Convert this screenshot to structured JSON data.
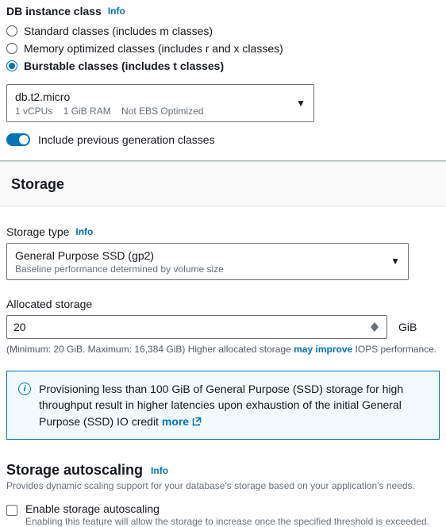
{
  "instance_class": {
    "label": "DB instance class",
    "info": "Info",
    "options": [
      {
        "label": "Standard classes (includes m classes)",
        "selected": false
      },
      {
        "label": "Memory optimized classes (includes r and x classes)",
        "selected": false
      },
      {
        "label": "Burstable classes (includes t classes)",
        "selected": true
      }
    ],
    "selected_instance": {
      "name": "db.t2.micro",
      "specs": {
        "vcpu": "1 vCPUs",
        "ram": "1 GiB RAM",
        "ebs": "Not EBS Optimized"
      }
    },
    "include_prev_toggle": {
      "label": "Include previous generation classes",
      "on": true
    }
  },
  "storage": {
    "heading": "Storage",
    "type": {
      "label": "Storage type",
      "info": "Info",
      "selected": "General Purpose SSD (gp2)",
      "sub": "Baseline performance determined by volume size"
    },
    "allocated": {
      "label": "Allocated storage",
      "value": "20",
      "unit": "GiB",
      "hint_prefix": "(Minimum: 20 GiB. Maximum: 16,384 GiB) Higher allocated storage ",
      "hint_link": "may improve",
      "hint_suffix": " IOPS performance."
    },
    "info_box": {
      "text": "Provisioning less than 100 GiB of General Purpose (SSD) storage for high throughput result in higher latencies upon exhaustion of the initial General Purpose (SSD) IO credit",
      "more": "more"
    },
    "autoscaling": {
      "title": "Storage autoscaling",
      "info": "Info",
      "desc": "Provides dynamic scaling support for your database's storage based on your application's needs.",
      "checkbox": {
        "label": "Enable storage autoscaling",
        "sub": "Enabling this feature will allow the storage to increase once the specified threshold is exceeded.",
        "checked": false
      }
    }
  }
}
